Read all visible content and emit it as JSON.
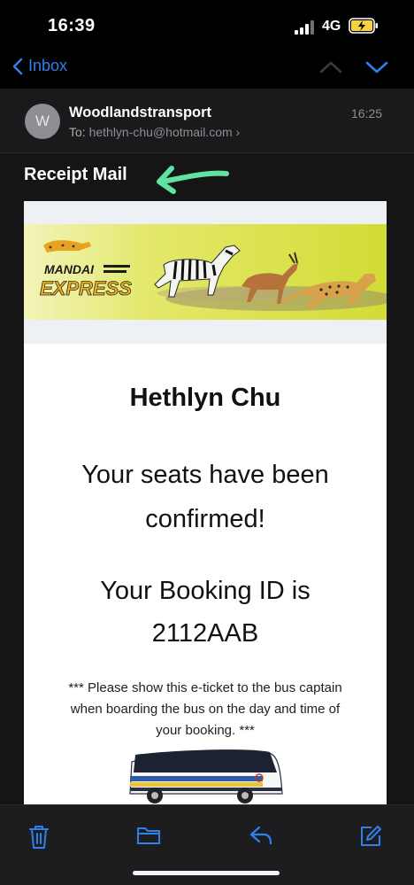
{
  "status_bar": {
    "time": "16:39",
    "network": "4G"
  },
  "nav": {
    "back_label": "Inbox"
  },
  "email": {
    "avatar_initial": "W",
    "sender": "Woodlandstransport",
    "to_label": "To:",
    "to_address": "hethlyn-chu@hotmail.com",
    "to_chevron": "›",
    "time": "16:25",
    "subject": "Receipt Mail"
  },
  "body": {
    "brand_line1": "MANDAI",
    "brand_line2": "EXPRESS",
    "name": "Hethlyn Chu",
    "confirm_line1": "Your seats have been",
    "confirm_line2": "confirmed!",
    "booking_line1": "Your Booking ID is",
    "booking_id": "2112AAB",
    "notice": "*** Please show this e-ticket to the bus captain when boarding the bus on the day and time of your booking. ***"
  },
  "colors": {
    "accent": "#2f80ed",
    "annotation_arrow": "#5fe3a1",
    "banner_bg": "#d7e04a"
  },
  "icons": [
    "chevron-left-icon",
    "chevron-up-icon",
    "chevron-down-icon",
    "trash-icon",
    "folder-icon",
    "reply-icon",
    "compose-icon"
  ]
}
